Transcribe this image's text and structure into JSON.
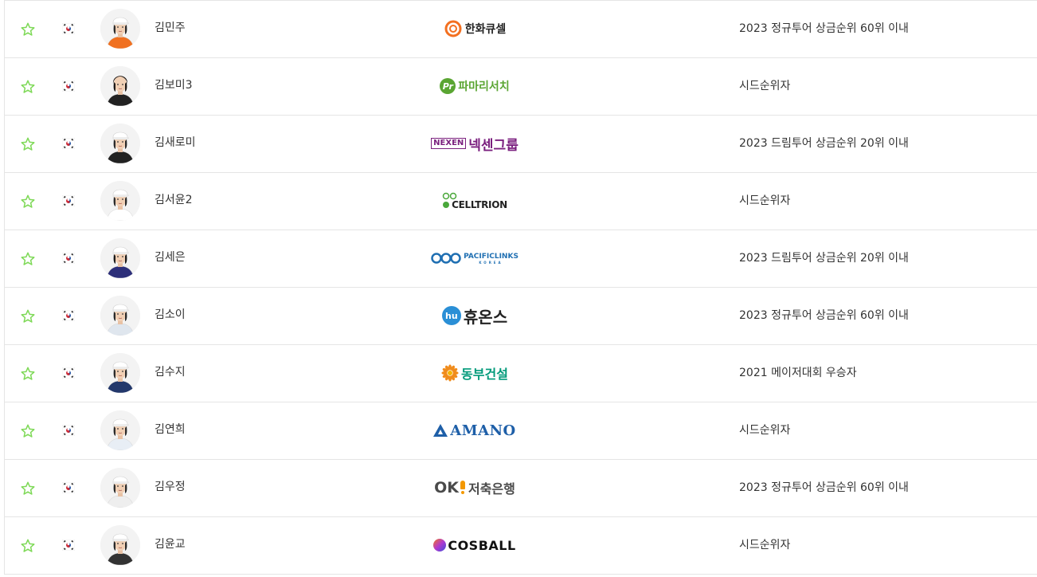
{
  "players": [
    {
      "name": "김민주",
      "qualification": "2023 정규투어 상금순위 60위 이내",
      "sponsor": {
        "logo": "hanwha-qcells",
        "text": "한화큐셀",
        "color": "#f37021"
      }
    },
    {
      "name": "김보미3",
      "qualification": "시드순위자",
      "sponsor": {
        "logo": "pamari-search",
        "text": "파마리서치",
        "color": "#5aa532"
      }
    },
    {
      "name": "김새로미",
      "qualification": "2023 드림투어 상금순위 20위 이내",
      "sponsor": {
        "logo": "nexen-group",
        "text": "넥센그룹",
        "prefix": "NEXEN",
        "color": "#7a1f7e"
      }
    },
    {
      "name": "김서윤2",
      "qualification": "시드순위자",
      "sponsor": {
        "logo": "celltrion",
        "text": "CELLTRION",
        "color": "#4aa83b"
      }
    },
    {
      "name": "김세은",
      "qualification": "2023 드림투어 상금순위 20위 이내",
      "sponsor": {
        "logo": "pacific-links",
        "text": "PACIFICLINKS",
        "sub": "KOREA",
        "color": "#1f6fb2"
      }
    },
    {
      "name": "김소이",
      "qualification": "2023 정규투어 상금순위 60위 이내",
      "sponsor": {
        "logo": "huons",
        "text": "휴온스",
        "badge": "hu",
        "color": "#222222"
      }
    },
    {
      "name": "김수지",
      "qualification": "2021 메이저대회 우승자",
      "sponsor": {
        "logo": "dongbu-construction",
        "text": "동부건설",
        "color": "#009a7a"
      }
    },
    {
      "name": "김연희",
      "qualification": "시드순위자",
      "sponsor": {
        "logo": "amano",
        "text": "AMANO",
        "color": "#1e5fa8"
      }
    },
    {
      "name": "김우정",
      "qualification": "2023 정규투어 상금순위 60위 이내",
      "sponsor": {
        "logo": "ok-savings-bank",
        "text": "저축은행",
        "prefix": "OK",
        "color": "#4a4a4a"
      }
    },
    {
      "name": "김윤교",
      "qualification": "시드순위자",
      "sponsor": {
        "logo": "cosball",
        "text": "COSBALL",
        "color": "#111111"
      }
    }
  ],
  "colors": {
    "star": "#7ed957",
    "divider": "#e5e5e5",
    "text": "#333333"
  },
  "icons": {
    "favorite": "star-outline-icon",
    "nationality": "korea-flag-icon"
  }
}
